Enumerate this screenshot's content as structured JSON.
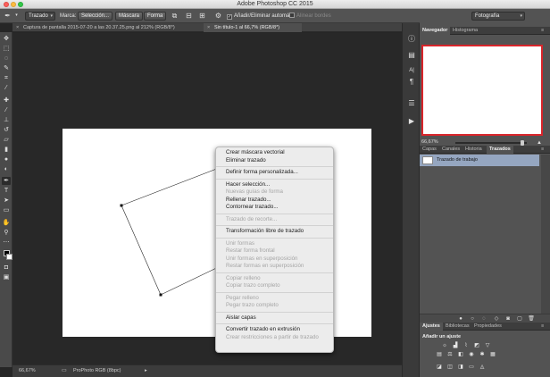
{
  "window": {
    "title": "Adobe Photoshop CC 2015"
  },
  "options_bar": {
    "mode_value": "Trazado",
    "marca_label": "Marca:",
    "seleccion_button": "Selección...",
    "mascara_button": "Máscara",
    "forma_button": "Forma",
    "auto_add_label": "Añadir/Eliminar automát.",
    "align_edges_label": "Alinear bordes",
    "workspace_value": "Fotografía"
  },
  "tabs": [
    {
      "label": "Captura de pantalla 2015-07-20 a las 20.37.25.png al 212% (RGB/8*)",
      "active": false
    },
    {
      "label": "Sin título-1 al 66,7% (RGB/8*)",
      "active": true
    }
  ],
  "status_bar": {
    "zoom": "66,67%",
    "profile": "ProPhoto RGB (8bpc)"
  },
  "context_menu": {
    "groups": [
      [
        {
          "label": "Crear máscara vectorial",
          "enabled": true
        },
        {
          "label": "Eliminar trazado",
          "enabled": true
        }
      ],
      [
        {
          "label": "Definir forma personalizada...",
          "enabled": true
        }
      ],
      [
        {
          "label": "Hacer selección...",
          "enabled": true
        },
        {
          "label": "Nuevas guías de forma",
          "enabled": false
        },
        {
          "label": "Rellenar trazado...",
          "enabled": true
        },
        {
          "label": "Contornear trazado...",
          "enabled": true
        }
      ],
      [
        {
          "label": "Trazado de recorte...",
          "enabled": false
        }
      ],
      [
        {
          "label": "Transformación libre de trazado",
          "enabled": true
        }
      ],
      [
        {
          "label": "Unir formas",
          "enabled": false
        },
        {
          "label": "Restar forma frontal",
          "enabled": false
        },
        {
          "label": "Unir formas en superposición",
          "enabled": false
        },
        {
          "label": "Restar formas en superposición",
          "enabled": false
        }
      ],
      [
        {
          "label": "Copiar relleno",
          "enabled": false
        },
        {
          "label": "Copiar trazo completo",
          "enabled": false
        }
      ],
      [
        {
          "label": "Pegar relleno",
          "enabled": false
        },
        {
          "label": "Pegar trazo completo",
          "enabled": false
        }
      ],
      [
        {
          "label": "Aislar capas",
          "enabled": true
        }
      ],
      [
        {
          "label": "Convertir trazado en extrusión",
          "enabled": true
        },
        {
          "label": "Crear restricciones a partir de trazado",
          "enabled": false
        }
      ]
    ]
  },
  "navigator_panel": {
    "tabs": [
      "Navegador",
      "Histograma"
    ],
    "zoom": "66,67%"
  },
  "layers_panel": {
    "tabs": [
      "Capas",
      "Canales",
      "Historia",
      "Trazados"
    ],
    "paths": [
      "Trazado de trabajo"
    ]
  },
  "adjustments_panel": {
    "tabs": [
      "Ajustes",
      "Bibliotecas",
      "Propiedades"
    ],
    "title": "Añadir un ajuste"
  },
  "colors": {
    "selected_path_row": "#95a6c0",
    "navigator_frame": "#d9252b"
  }
}
